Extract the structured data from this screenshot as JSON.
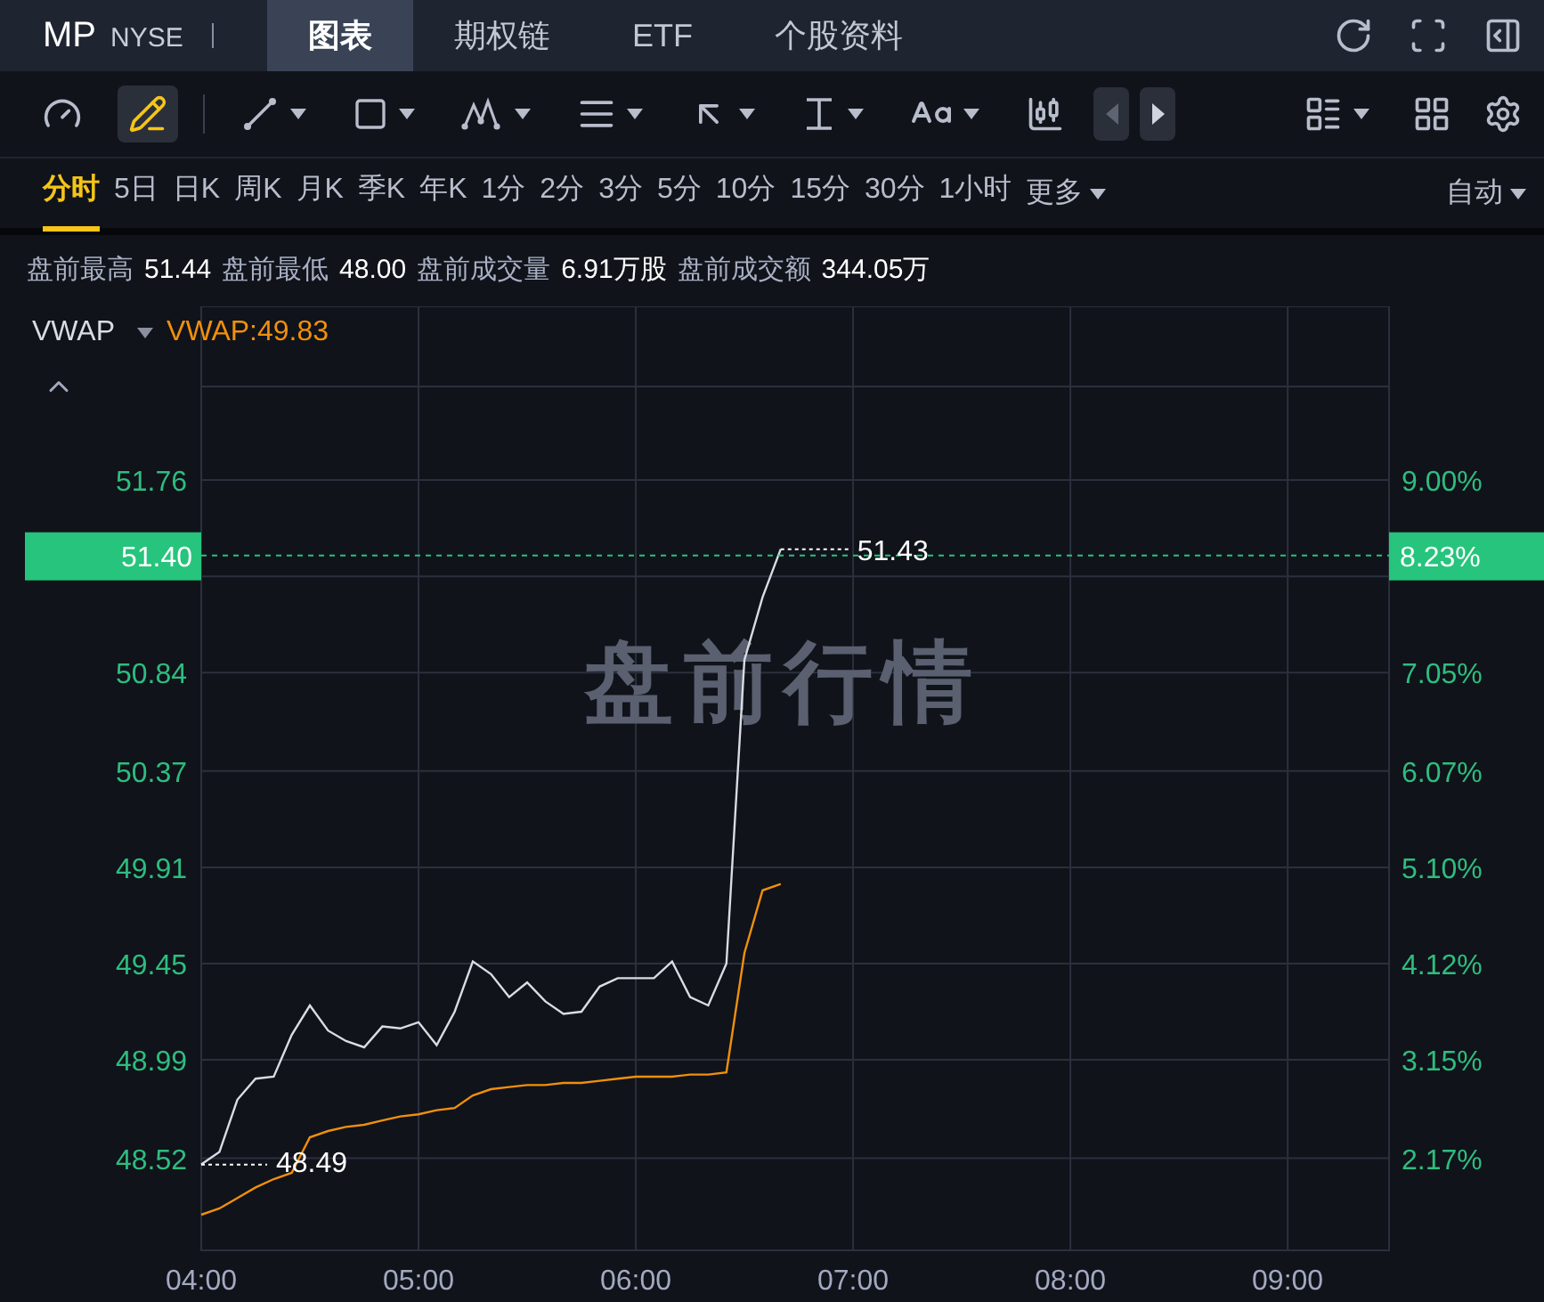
{
  "header": {
    "symbol": "MP",
    "exchange": "NYSE",
    "tabs": [
      {
        "label": "图表",
        "selected": true
      },
      {
        "label": "期权链",
        "selected": false
      },
      {
        "label": "ETF",
        "selected": false
      },
      {
        "label": "个股资料",
        "selected": false
      }
    ]
  },
  "toolbar": {
    "draw_mode_on": true,
    "scroll_back_disabled": true
  },
  "periods": [
    {
      "label": "分时",
      "selected": true
    },
    {
      "label": "5日",
      "selected": false
    },
    {
      "label": "日K",
      "selected": false
    },
    {
      "label": "周K",
      "selected": false
    },
    {
      "label": "月K",
      "selected": false
    },
    {
      "label": "季K",
      "selected": false
    },
    {
      "label": "年K",
      "selected": false
    },
    {
      "label": "1分",
      "selected": false
    },
    {
      "label": "2分",
      "selected": false
    },
    {
      "label": "3分",
      "selected": false
    },
    {
      "label": "5分",
      "selected": false
    },
    {
      "label": "10分",
      "selected": false
    },
    {
      "label": "15分",
      "selected": false
    },
    {
      "label": "30分",
      "selected": false
    },
    {
      "label": "1小时",
      "selected": false
    }
  ],
  "more_menu": "更多",
  "scale_mode": "自动",
  "stats": [
    {
      "label": "盘前最高",
      "value": "51.44"
    },
    {
      "label": "盘前最低",
      "value": "48.00"
    },
    {
      "label": "盘前成交量",
      "value": "6.91万股"
    },
    {
      "label": "盘前成交额",
      "value": "344.05万"
    }
  ],
  "indicator": {
    "reading": "VWAP:49.83"
  },
  "chart": {
    "watermark": "盘前行情",
    "last_price_tag": "51.40",
    "last_change_tag": "8.23%",
    "high_label": "51.43",
    "low_label": "48.49",
    "right_axis_labels": [
      "9.00%",
      "7.05%",
      "6.07%",
      "5.10%",
      "4.12%",
      "3.15%",
      "2.17%"
    ],
    "chart_data": {
      "type": "line",
      "grid": true,
      "ylim": [
        48.08,
        52.59
      ],
      "ref_lines": [
        {
          "axis": "y",
          "value": 51.4,
          "color": "#26c47c"
        }
      ],
      "categories": [
        "04:00",
        null,
        null,
        null,
        null,
        null,
        null,
        null,
        null,
        null,
        null,
        null,
        "05:00",
        null,
        null,
        null,
        null,
        null,
        null,
        null,
        null,
        null,
        null,
        null,
        "06:00",
        null,
        null,
        null,
        null,
        null,
        null,
        null,
        null,
        null,
        null,
        null,
        "07:00",
        null,
        null,
        null,
        null,
        null,
        null,
        null,
        null,
        null,
        null,
        null,
        "08:00",
        null,
        null,
        null,
        null,
        null,
        null,
        null,
        null,
        null,
        null,
        null,
        "09:00",
        null,
        null,
        null,
        null,
        null
      ],
      "yticks": [
        {
          "value": 51.76,
          "label": "51.76"
        },
        {
          "value": 50.84,
          "label": "50.84"
        },
        {
          "value": 50.37,
          "label": "50.37"
        },
        {
          "value": 49.91,
          "label": "49.91"
        },
        {
          "value": 49.45,
          "label": "49.45"
        },
        {
          "value": 48.99,
          "label": "48.99"
        },
        {
          "value": 48.52,
          "label": "48.52"
        }
      ],
      "series": [
        {
          "color": "#d9dce3",
          "values": [
            48.49,
            48.55,
            48.8,
            48.9,
            48.91,
            49.11,
            49.25,
            49.13,
            49.08,
            49.05,
            49.15,
            49.14,
            49.17,
            49.06,
            49.22,
            49.46,
            49.4,
            49.29,
            49.36,
            49.27,
            49.21,
            49.22,
            49.34,
            49.38,
            49.38,
            49.38,
            49.46,
            49.29,
            49.25,
            49.45,
            50.9,
            51.2,
            51.43,
            null,
            null,
            null,
            null,
            null,
            null,
            null,
            null,
            null,
            null,
            null,
            null,
            null,
            null,
            null,
            null,
            null,
            null,
            null,
            null,
            null,
            null,
            null,
            null,
            null,
            null,
            null,
            null,
            null,
            null,
            null,
            null,
            null
          ]
        },
        {
          "name": "VWAP",
          "color": "#f0900c",
          "values": [
            48.25,
            48.28,
            48.33,
            48.38,
            48.42,
            48.45,
            48.62,
            48.65,
            48.67,
            48.68,
            48.7,
            48.72,
            48.73,
            48.75,
            48.76,
            48.82,
            48.85,
            48.86,
            48.87,
            48.87,
            48.88,
            48.88,
            48.89,
            48.9,
            48.91,
            48.91,
            48.91,
            48.92,
            48.92,
            48.93,
            49.5,
            49.8,
            49.83,
            null,
            null,
            null,
            null,
            null,
            null,
            null,
            null,
            null,
            null,
            null,
            null,
            null,
            null,
            null,
            null,
            null,
            null,
            null,
            null,
            null,
            null,
            null,
            null,
            null,
            null,
            null,
            null,
            null,
            null,
            null,
            null,
            null
          ]
        }
      ]
    }
  }
}
